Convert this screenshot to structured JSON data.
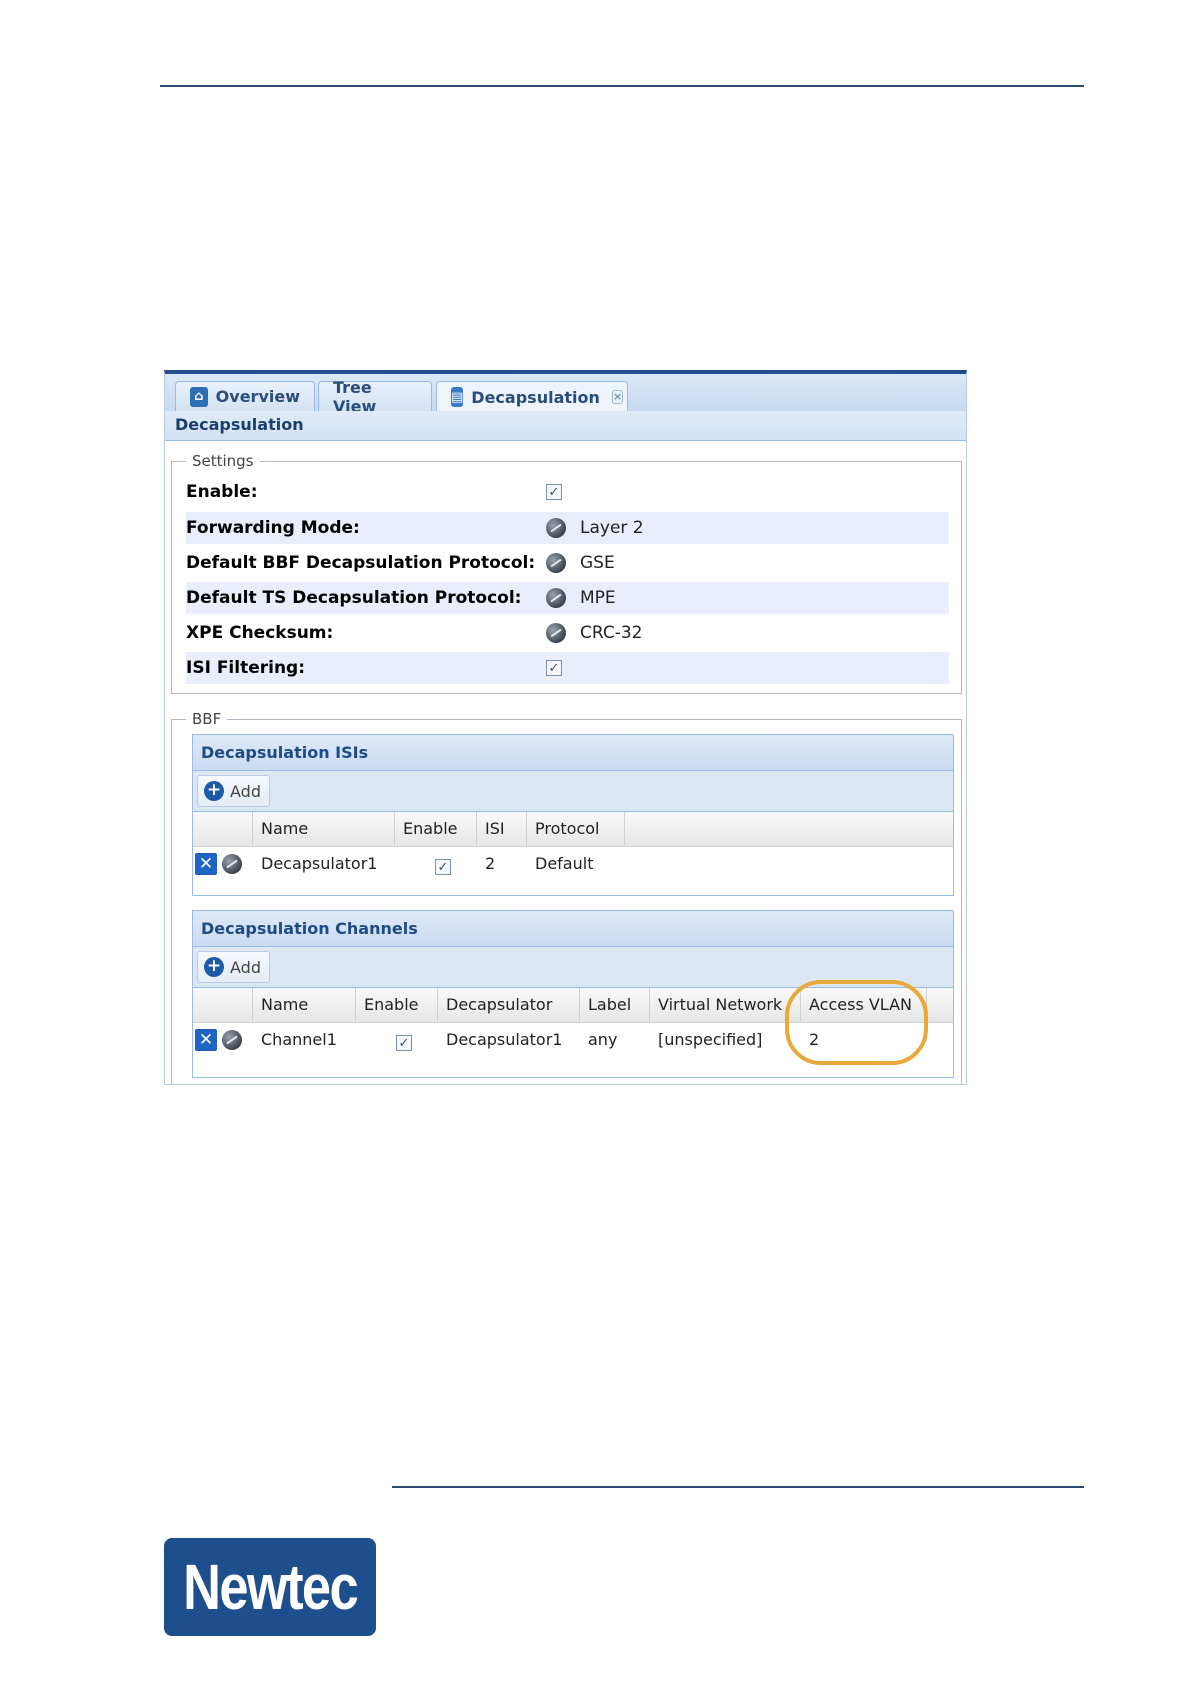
{
  "tabs": [
    {
      "label": "Overview",
      "icon": "home-icon"
    },
    {
      "label": "Tree View"
    },
    {
      "label": "Decapsulation",
      "icon": "document-icon",
      "closable": true
    }
  ],
  "panel_title": "Decapsulation",
  "settings": {
    "legend": "Settings",
    "rows": [
      {
        "label": "Enable:",
        "value": "",
        "type": "checkbox",
        "checked": true
      },
      {
        "label": "Forwarding Mode:",
        "value": "Layer 2",
        "type": "select"
      },
      {
        "label": "Default BBF Decapsulation Protocol:",
        "value": "GSE",
        "type": "select"
      },
      {
        "label": "Default TS Decapsulation Protocol:",
        "value": "MPE",
        "type": "select"
      },
      {
        "label": "XPE Checksum:",
        "value": "CRC-32",
        "type": "select"
      },
      {
        "label": "ISI Filtering:",
        "value": "",
        "type": "checkbox",
        "checked": true
      }
    ]
  },
  "bbf": {
    "legend": "BBF",
    "isis": {
      "title": "Decapsulation ISIs",
      "add_label": "Add",
      "columns": [
        "Name",
        "Enable",
        "ISI",
        "Protocol"
      ],
      "rows": [
        {
          "name": "Decapsulator1",
          "enable": true,
          "isi": "2",
          "protocol": "Default"
        }
      ]
    },
    "channels": {
      "title": "Decapsulation Channels",
      "add_label": "Add",
      "columns": [
        "Name",
        "Enable",
        "Decapsulator",
        "Label",
        "Virtual Network",
        "Access VLAN"
      ],
      "rows": [
        {
          "name": "Channel1",
          "enable": true,
          "decapsulator": "Decapsulator1",
          "label": "any",
          "virtual_network": "[unspecified]",
          "access_vlan": "2"
        }
      ]
    }
  },
  "logo": {
    "text": "Newtec",
    "color": "#1f4e8c"
  },
  "colors": {
    "accent": "#1f4f8f",
    "highlight": "#e8a93a"
  }
}
